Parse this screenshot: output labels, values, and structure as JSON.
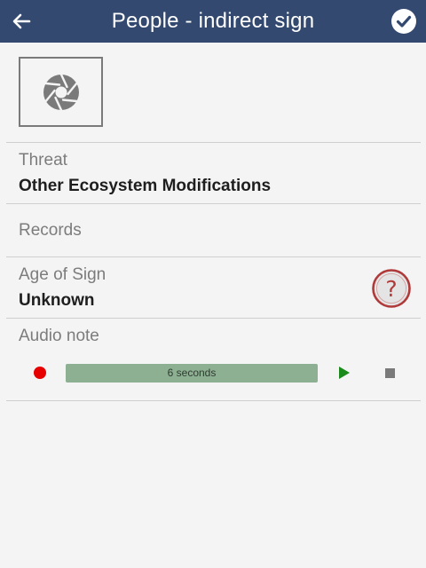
{
  "header": {
    "title": "People - indirect sign",
    "back_icon": "arrow-left-icon",
    "confirm_icon": "check-circle-icon"
  },
  "photo": {
    "icon": "camera-aperture-icon"
  },
  "fields": {
    "threat": {
      "label": "Threat",
      "value": "Other Ecosystem Modifications"
    },
    "records": {
      "label": "Records"
    },
    "age_of_sign": {
      "label": "Age of Sign",
      "value": "Unknown",
      "help_icon": "question-circle-icon"
    },
    "audio_note": {
      "label": "Audio note",
      "duration_text": "6 seconds"
    }
  },
  "colors": {
    "header_bg": "#34496f",
    "record": "#e60000",
    "play": "#1a8a1a",
    "progress_bg": "#8daf92",
    "help_ring": "#b03a3a"
  }
}
